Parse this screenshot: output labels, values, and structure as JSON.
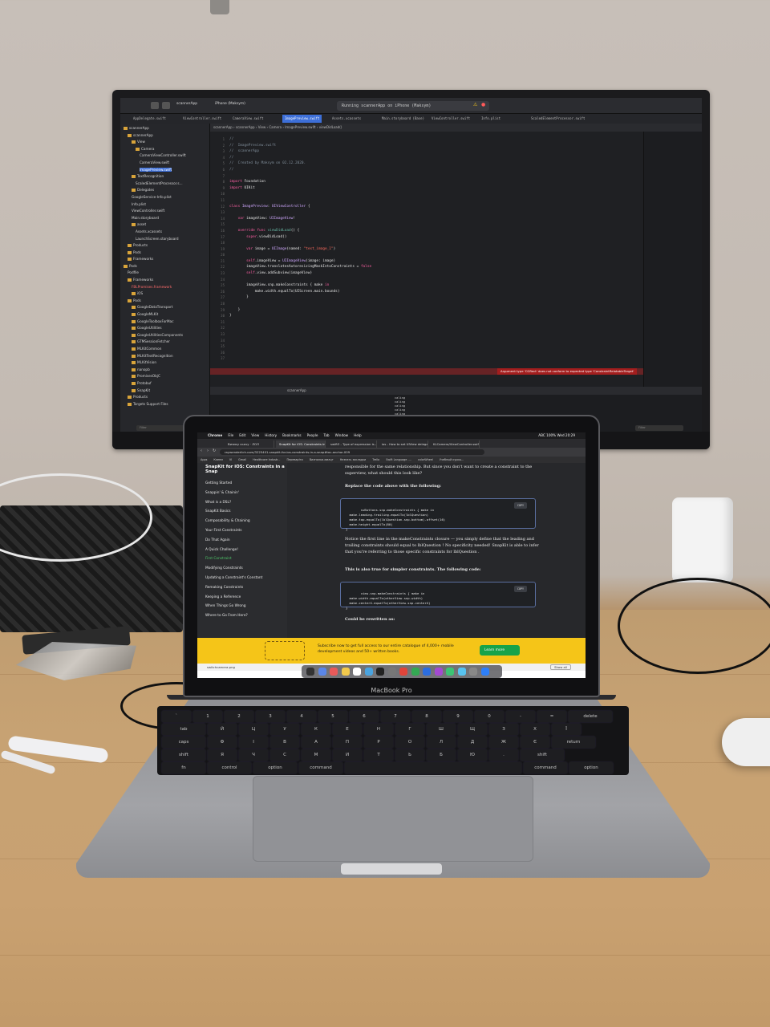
{
  "monitor": {
    "xcode": {
      "scheme": "scannerApp",
      "device": "iPhone (Maksym)",
      "status": "Running scannerApp on iPhone (Maksym)",
      "tabs": [
        "AppDelegate.swift",
        "ViewController.swift",
        "CameraView.swift",
        "ImagePreview.swift",
        "Assets.xcassets",
        "Main.storyboard (Base)",
        "ViewController.swift",
        "Info.plist",
        "ScaledElementProcessor.swift"
      ],
      "active_tab": "ImagePreview.swift",
      "breadcrumb": "scannerApp  ›  scannerApp  ›  View  ›  Camera  ›  ImagePreview.swift  ›  viewDidLoad()",
      "navigator": [
        {
          "label": "scannerApp",
          "type": "folder",
          "level": 0
        },
        {
          "label": "scannerApp",
          "type": "folder",
          "level": 1
        },
        {
          "label": "View",
          "type": "folder",
          "level": 2
        },
        {
          "label": "Camera",
          "type": "folder",
          "level": 3
        },
        {
          "label": "CameraViewController.swift",
          "type": "file",
          "level": 4
        },
        {
          "label": "CameraView.swift",
          "type": "file",
          "level": 4
        },
        {
          "label": "ImagePreview.swift",
          "type": "file",
          "level": 4,
          "selected": true
        },
        {
          "label": "TextRecognition",
          "type": "folder",
          "level": 2
        },
        {
          "label": "ScaledElementProcessor.s...",
          "type": "file",
          "level": 3
        },
        {
          "label": "Delegates",
          "type": "folder",
          "level": 2
        },
        {
          "label": "GoogleService-Info.plist",
          "type": "file",
          "level": 2
        },
        {
          "label": "Info.plist",
          "type": "file",
          "level": 2
        },
        {
          "label": "ViewController.swift",
          "type": "file",
          "level": 2
        },
        {
          "label": "Main.storyboard",
          "type": "file",
          "level": 2
        },
        {
          "label": "asset",
          "type": "folder",
          "level": 2
        },
        {
          "label": "Assets.xcassets",
          "type": "file",
          "level": 3
        },
        {
          "label": "LaunchScreen.storyboard",
          "type": "file",
          "level": 3
        },
        {
          "label": "Products",
          "type": "folder",
          "level": 1
        },
        {
          "label": "Pods",
          "type": "folder",
          "level": 1
        },
        {
          "label": "Frameworks",
          "type": "folder",
          "level": 1
        },
        {
          "label": "Pods",
          "type": "folder",
          "level": 0
        },
        {
          "label": "Podfile",
          "type": "file",
          "level": 1
        },
        {
          "label": "Frameworks",
          "type": "folder",
          "level": 1
        },
        {
          "label": "FBLPromises.framework",
          "type": "file",
          "level": 2,
          "error": true
        },
        {
          "label": "iOS",
          "type": "folder",
          "level": 2
        },
        {
          "label": "Pods",
          "type": "folder",
          "level": 1
        },
        {
          "label": "GoogleDataTransport",
          "type": "folder",
          "level": 2
        },
        {
          "label": "GoogleMLKit",
          "type": "folder",
          "level": 2
        },
        {
          "label": "GoogleToolboxForMac",
          "type": "folder",
          "level": 2
        },
        {
          "label": "GoogleUtilities",
          "type": "folder",
          "level": 2
        },
        {
          "label": "GoogleUtilitiesComponents",
          "type": "folder",
          "level": 2
        },
        {
          "label": "GTMSessionFetcher",
          "type": "folder",
          "level": 2
        },
        {
          "label": "MLKitCommon",
          "type": "folder",
          "level": 2
        },
        {
          "label": "MLKitTextRecognition",
          "type": "folder",
          "level": 2
        },
        {
          "label": "MLKitVision",
          "type": "folder",
          "level": 2
        },
        {
          "label": "nanopb",
          "type": "folder",
          "level": 2
        },
        {
          "label": "PromisesObjC",
          "type": "folder",
          "level": 2
        },
        {
          "label": "Protobuf",
          "type": "folder",
          "level": 2
        },
        {
          "label": "SnapKit",
          "type": "folder",
          "level": 2
        },
        {
          "label": "Products",
          "type": "folder",
          "level": 1
        },
        {
          "label": "Targets Support Files",
          "type": "folder",
          "level": 1
        }
      ],
      "filter_placeholder": "Filter",
      "error_message": "Argument type 'CGRect' does not conform to expected type 'ConstraintRelatableTarget'",
      "debug_target": "scannerApp",
      "console_lines": [
        "caling",
        "caling",
        "caling",
        "caling",
        "caling",
        "caling",
        "caling"
      ]
    }
  },
  "laptop": {
    "brand": "MacBook Pro",
    "menubar": {
      "items": [
        "Chrome",
        "File",
        "Edit",
        "View",
        "History",
        "Bookmarks",
        "People",
        "Tab",
        "Window",
        "Help"
      ],
      "status": "ABC  100%  Wed 20:29"
    },
    "tabs": [
      "Визику скачу · ЛОЛ",
      "SnapKit for iOS: Constraints in...",
      "swift3 - Type of expression is...",
      "ios - How to set UIView delega...",
      "KLCamera/ViewController.swift..."
    ],
    "active_tab": "SnapKit for iOS: Constraints in...",
    "url": "raywenderlich.com/3225401-snapkit-for-ios-constraints-in-a-snap#toc-anchor-009",
    "bookmarks": [
      "Apps",
      "Клепм",
      "VI",
      "Gmail",
      "Healthcare Industr...",
      "Переваріти",
      "Вилнилки-милцт",
      "Незнать закладки",
      "Trello",
      "Swift Language -...",
      "colorWheel",
      "Учебный курсы..."
    ],
    "tutorial": {
      "title": "SnapKit for iOS: Constraints in a Snap",
      "sections": [
        "Getting Started",
        "Snappin' & Chainin'",
        "What is a DSL?",
        "SnapKit Basics",
        "Composability & Chaining",
        "Your First Constraints",
        "Do That Again",
        "A Quick Challenge!",
        "First Constraint",
        "Modifying Constraints",
        "Updating a Constraint's Constant",
        "Remaking Constraints",
        "Keeping a Reference",
        "When Things Go Wrong",
        "Where to Go From Here?"
      ],
      "current_section": "First Constraint",
      "para1": "responsible for the same relationship. But since you don't want to create a constraint to the superview, what should this look like?",
      "para2": "Replace the code above with the following:",
      "code1": "svButtons.snp.makeConstraints { make in\n  make.leading.trailing.equalTo(lblQuestion)\n  make.top.equalTo(lblQuestion.snp.bottom).offset(16)\n  make.height.equalTo(80)\n}",
      "para3": "Notice the first line in the makeConstraints closure — you simply define that the leading and trailing constraints should equal to lblQuestion ! No specificity needed! SnapKit is able to infer that you're referring to those specific constraints for lblQuestion .",
      "para4": "This is also true for simpler constraints. The following code:",
      "code2": "view.snp.makeConstraints { make in\n  make.width.equalTo(otherView.snp.width)\n  make.centerX.equalTo(otherView.snp.centerX)\n}",
      "para5": "Could be rewritten as:",
      "copy_label": "COPY"
    },
    "banner": {
      "text": "Subscribe now to get full access to our entire catalogue of 4,000+ mobile development videos and 50+ written books.",
      "button": "Learn more"
    },
    "download": {
      "file": "switchcamera.png",
      "show_all": "Show all"
    },
    "keyboard": {
      "row1": [
        "`",
        "1",
        "2",
        "3",
        "4",
        "5",
        "6",
        "7",
        "8",
        "9",
        "0",
        "-",
        "=",
        "delete"
      ],
      "row2": [
        "tab",
        "Й",
        "Ц",
        "У",
        "К",
        "Е",
        "Н",
        "Г",
        "Ш",
        "Щ",
        "З",
        "Х",
        "Ї"
      ],
      "row3": [
        "caps",
        "Ф",
        "І",
        "В",
        "А",
        "П",
        "Р",
        "О",
        "Л",
        "Д",
        "Ж",
        "Є",
        "return"
      ],
      "row4": [
        "shift",
        "Я",
        "Ч",
        "С",
        "М",
        "И",
        "Т",
        "Ь",
        "Б",
        "Ю",
        ".",
        "shift"
      ],
      "row5": [
        "fn",
        "control",
        "option",
        "command",
        "",
        "command",
        "option"
      ]
    }
  },
  "colors": {
    "wall": "#c7bfb8",
    "desk": "#c9a171",
    "xcode_bg": "#1f2023",
    "banner": "#f5c518",
    "accent_green": "#17a34a"
  }
}
